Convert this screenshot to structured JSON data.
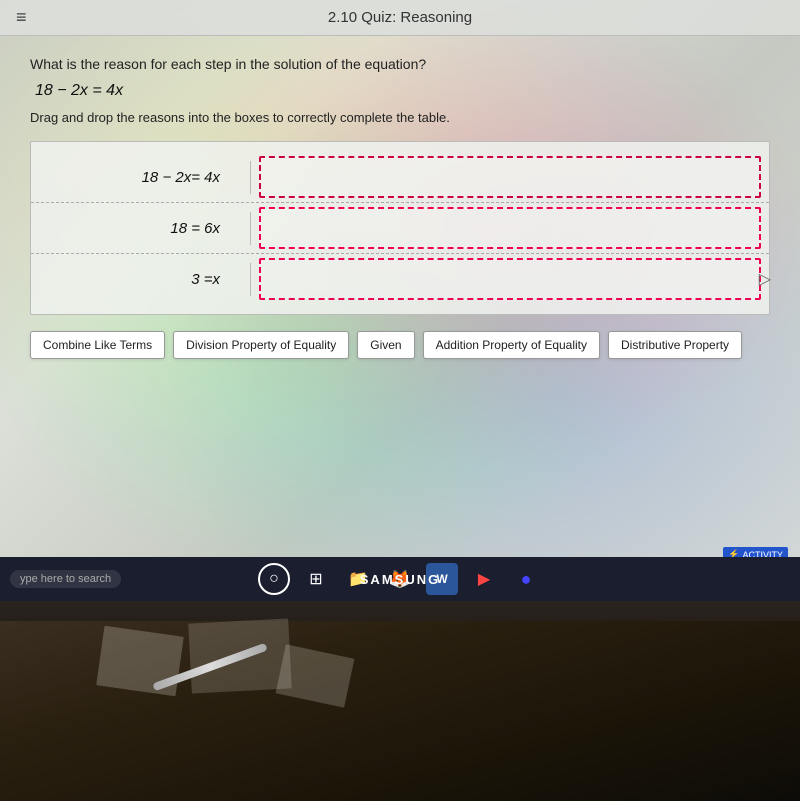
{
  "topBar": {
    "hamburger": "≡",
    "title": "2.10 Quiz: Reasoning"
  },
  "content": {
    "questionText": "What is the reason for each step in the solution of the equation?",
    "equation": "18 − 2x = 4x",
    "dragInstruction": "Drag and drop the reasons into the boxes to correctly complete the table.",
    "tableRows": [
      {
        "leftCell": "18 − 2x = 4x",
        "rightCell": ""
      },
      {
        "leftCell": "18 = 6x",
        "rightCell": ""
      },
      {
        "leftCell": "3 = x",
        "rightCell": ""
      }
    ],
    "options": [
      {
        "id": "combine-like-terms",
        "label": "Combine Like Terms"
      },
      {
        "id": "division-property",
        "label": "Division Property of Equality"
      },
      {
        "id": "given",
        "label": "Given"
      },
      {
        "id": "addition-property",
        "label": "Addition Property of Equality"
      },
      {
        "id": "distributive-property",
        "label": "Distributive Property"
      }
    ],
    "activityBadge": "ACTIVITY"
  },
  "taskbar": {
    "searchPlaceholder": "ype here to search",
    "brandLabel": "SAMSUNG"
  }
}
